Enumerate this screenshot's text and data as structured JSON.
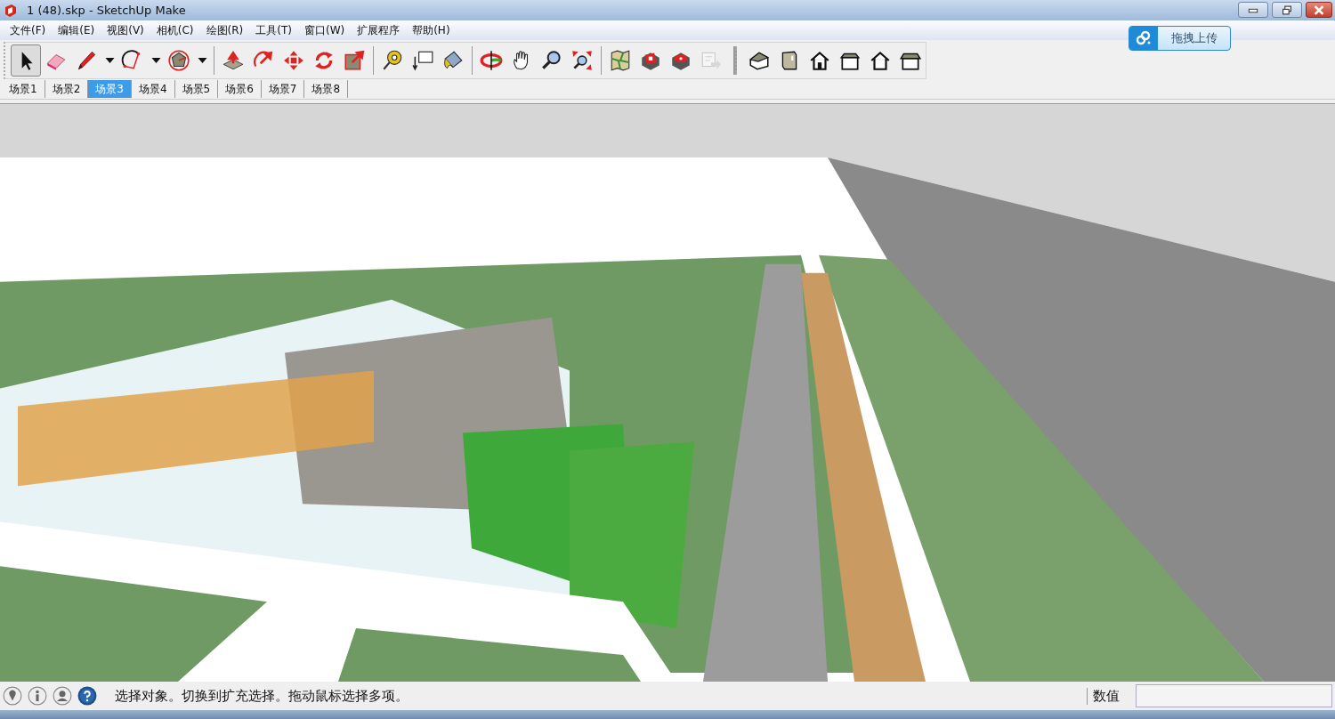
{
  "window": {
    "title": "1 (48).skp - SketchUp Make"
  },
  "menu": [
    "文件(F)",
    "编辑(E)",
    "视图(V)",
    "相机(C)",
    "绘图(R)",
    "工具(T)",
    "窗口(W)",
    "扩展程序",
    "帮助(H)"
  ],
  "upload_button": {
    "label": "拖拽上传"
  },
  "toolbar": {
    "tools": [
      {
        "selected": true,
        "disabled": false
      },
      {
        "selected": false,
        "disabled": false
      },
      {
        "selected": false,
        "disabled": false
      },
      {
        "selected": false,
        "disabled": false
      },
      {
        "selected": false,
        "disabled": false
      },
      {
        "selected": false,
        "disabled": false
      },
      {
        "selected": false,
        "disabled": false
      },
      {
        "selected": false,
        "disabled": false
      },
      {
        "selected": false,
        "disabled": false
      },
      {
        "selected": false,
        "disabled": false
      },
      {
        "selected": false,
        "disabled": false
      },
      {
        "selected": false,
        "disabled": false
      },
      {
        "selected": false,
        "disabled": false
      },
      {
        "selected": false,
        "disabled": false
      },
      {
        "selected": false,
        "disabled": false
      },
      {
        "selected": false,
        "disabled": false
      },
      {
        "selected": false,
        "disabled": false
      },
      {
        "selected": false,
        "disabled": false
      },
      {
        "selected": false,
        "disabled": false
      },
      {
        "selected": false,
        "disabled": false
      },
      {
        "selected": false,
        "disabled": true
      },
      {
        "selected": false,
        "disabled": false
      },
      {
        "selected": false,
        "disabled": false
      },
      {
        "selected": false,
        "disabled": false
      },
      {
        "selected": false,
        "disabled": false
      },
      {
        "selected": false,
        "disabled": false
      },
      {
        "selected": false,
        "disabled": false
      }
    ]
  },
  "scenes": [
    {
      "label": "场景1",
      "selected": false
    },
    {
      "label": "场景2",
      "selected": false
    },
    {
      "label": "场景3",
      "selected": true
    },
    {
      "label": "场景4",
      "selected": false
    },
    {
      "label": "场景5",
      "selected": false
    },
    {
      "label": "场景6",
      "selected": false
    },
    {
      "label": "场景7",
      "selected": false
    },
    {
      "label": "场景8",
      "selected": false
    }
  ],
  "status_bar": {
    "message": "选择对象。切换到扩充选择。拖动鼠标选择多项。",
    "measurement_label": "数值"
  }
}
